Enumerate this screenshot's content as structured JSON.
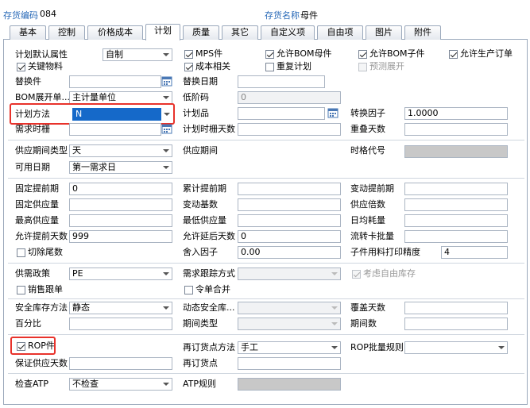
{
  "header": {
    "code_label": "存货编码",
    "code_value": "084",
    "name_label": "存货名称",
    "name_value": "母件"
  },
  "tabs": [
    "基本",
    "控制",
    "价格成本",
    "计划",
    "质量",
    "其它",
    "自定义项",
    "自由项",
    "图片",
    "附件"
  ],
  "active_tab": "计划",
  "plan": {
    "default_attr_label": "计划默认属性",
    "default_attr_value": "自制",
    "mps_label": "MPS件",
    "allow_bom_parent_label": "允许BOM母件",
    "allow_bom_child_label": "允许BOM子件",
    "allow_prod_order_label": "允许生产订单",
    "key_material_label": "关键物料",
    "cost_related_label": "成本相关",
    "reschedule_label": "重复计划",
    "forecast_expand_label": "预测展开",
    "replace_label": "替换件",
    "replace_date_label": "替换日期",
    "bom_expand_label": "BOM展开单...",
    "bom_expand_value": "主计量单位",
    "low_code_label": "低阶码",
    "low_code_value": "0",
    "plan_method_label": "计划方法",
    "plan_method_value": "N",
    "plan_item_label": "计划品",
    "convert_factor_label": "转换因子",
    "convert_factor_value": "1.0000",
    "demand_fence_label": "需求时栅",
    "plan_fence_days_label": "计划时栅天数",
    "overlap_days_label": "重叠天数"
  },
  "supply": {
    "period_type_label": "供应期间类型",
    "period_type_value": "天",
    "period_label": "供应期间",
    "time_code_label": "时格代号",
    "avail_date_label": "可用日期",
    "avail_date_value": "第一需求日"
  },
  "lead": {
    "fixed_lead_label": "固定提前期",
    "fixed_lead_value": "0",
    "cum_lead_label": "累计提前期",
    "var_lead_label": "变动提前期",
    "fixed_supply_label": "固定供应量",
    "var_base_label": "变动基数",
    "supply_multiple_label": "供应倍数",
    "max_supply_label": "最高供应量",
    "min_supply_label": "最低供应量",
    "daily_usage_label": "日均耗量",
    "allow_ahead_label": "允许提前天数",
    "allow_ahead_value": "999",
    "allow_delay_label": "允许延后天数",
    "allow_delay_value": "0",
    "flow_batch_label": "流转卡批量",
    "cut_tail_label": "切除尾数",
    "round_factor_label": "舍入因子",
    "round_factor_value": "0.00",
    "child_precision_label": "子件用料打印精度",
    "child_precision_value": "4"
  },
  "policy": {
    "policy_label": "供需政策",
    "policy_value": "PE",
    "trace_label": "需求跟踪方式",
    "consider_free_label": "考虑自由库存",
    "sales_follow_label": "销售跟单",
    "order_merge_label": "令单合并"
  },
  "safety": {
    "method_label": "安全库存方法",
    "method_value": "静态",
    "dyn_safety_label": "动态安全库...",
    "cover_days_label": "覆盖天数",
    "percent_label": "百分比",
    "period_type_label": "期间类型",
    "period_count_label": "期间数"
  },
  "rop": {
    "rop_label": "ROP件",
    "reorder_method_label": "再订货点方法",
    "reorder_method_value": "手工",
    "rop_batch_rule_label": "ROP批量规则",
    "guarantee_days_label": "保证供应天数",
    "reorder_point_label": "再订货点"
  },
  "atp": {
    "check_label": "检查ATP",
    "check_value": "不检查",
    "rule_label": "ATP规则"
  },
  "colors": {
    "accent": "#2a6ab8",
    "highlight": "#1569c9",
    "callout": "#e8322b"
  },
  "icons": {
    "calendar": "calendar-icon",
    "dropdown": "chevron-down-icon",
    "checkbox": "checkbox"
  }
}
